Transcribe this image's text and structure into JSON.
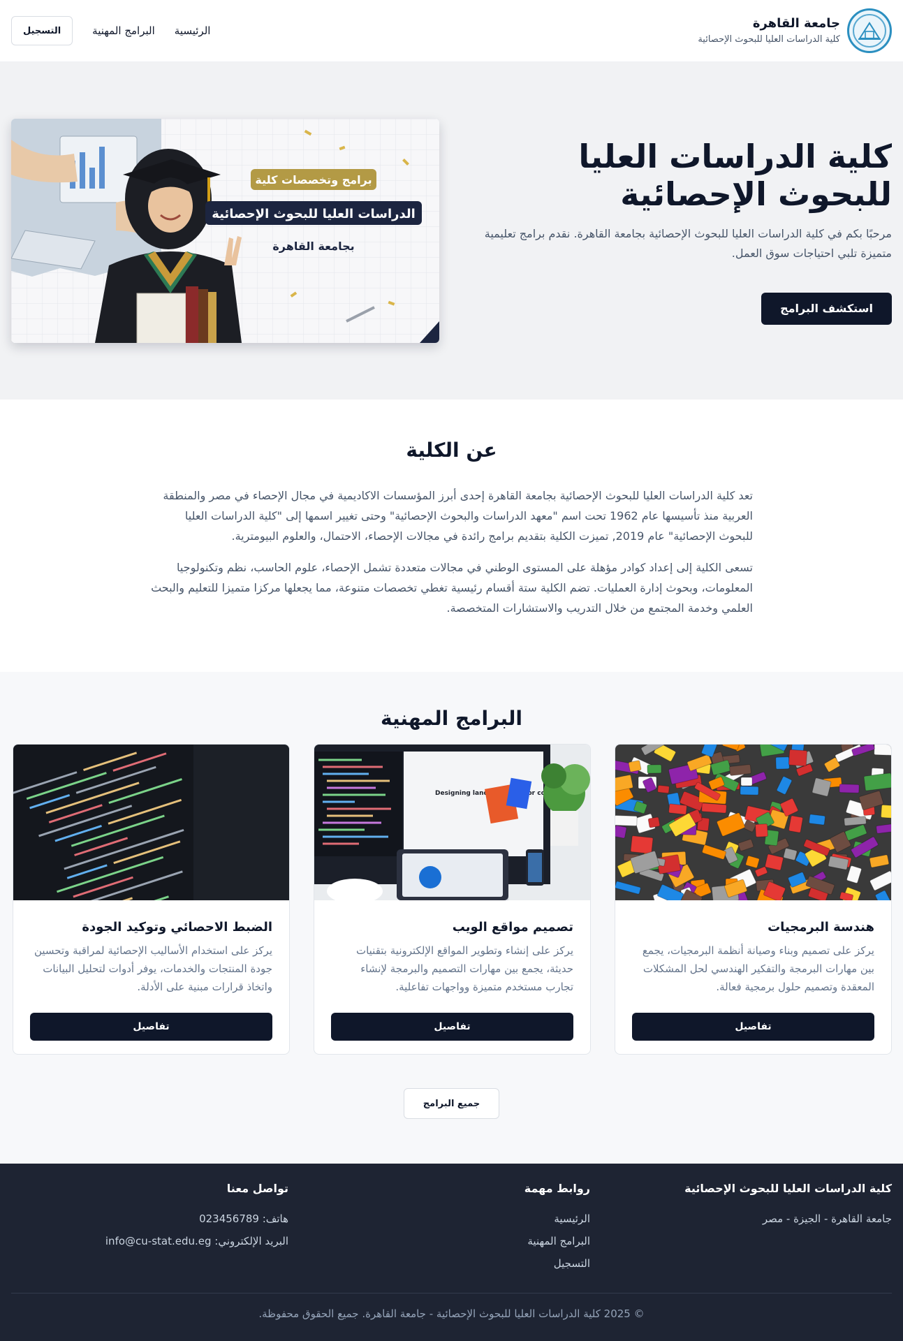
{
  "header": {
    "title": "جامعة القاهرة",
    "subtitle": "كلية الدراسات العليا للبحوث الإحصائية",
    "nav": [
      {
        "label": "الرئيسية"
      },
      {
        "label": "البرامج المهنية"
      }
    ],
    "register_label": "التسجيل"
  },
  "hero": {
    "title": "كلية الدراسات العليا للبحوث الإحصائية",
    "description": "مرحبًا بكم في كلية الدراسات العليا للبحوث الإحصائية بجامعة القاهرة. نقدم برامج تعليمية متميزة تلبي احتياجات سوق العمل.",
    "button_label": "استكشف البرامج",
    "image": {
      "badge": "برامج وتخصصات كلية",
      "headline": "الدراسات العليا للبحوث الإحصائية",
      "tagline": "بجامعة القاهرة"
    }
  },
  "about": {
    "title": "عن الكلية",
    "paragraphs": [
      "تعد كلية الدراسات العليا للبحوث الإحصائية بجامعة القاهرة إحدى أبرز المؤسسات الاكاديمية في مجال الإحصاء في مصر والمنطقة العربية منذ تأسيسها عام 1962 تحت اسم \"معهد الدراسات والبحوث الإحصائية\" وحتى تغيير اسمها إلى \"كلية الدراسات العليا للبحوث الإحصائية\" عام 2019, تميزت الكلية بتقديم برامج رائدة في مجالات الإحصاء، الاحتمال، والعلوم البيومترية.",
      "تسعى الكلية إلى إعداد كوادر مؤهلة على المستوى الوطني في مجالات متعددة تشمل الإحصاء، علوم الحاسب، نظم وتكنولوجيا المعلومات، وبحوث إدارة العمليات. تضم الكلية ستة أقسام رئيسية تغطي تخصصات متنوعة، مما يجعلها مركزا متميزا للتعليم والبحث العلمي وخدمة المجتمع من خلال التدريب والاستشارات المتخصصة."
    ]
  },
  "programs": {
    "title": "البرامج المهنية",
    "cards": [
      {
        "title": "هندسة البرمجيات",
        "description": "يركز على تصميم وبناء وصيانة أنظمة البرمجيات، يجمع بين مهارات البرمجة والتفكير الهندسي لحل المشكلات المعقدة وتصميم حلول برمجية فعالة.",
        "button_label": "تفاصيل",
        "image": "colorful-building-blocks"
      },
      {
        "title": "تصميم مواقع الويب",
        "description": "يركز على إنشاء وتطوير المواقع الإلكترونية بتقنيات حديثة، يجمع بين مهارات التصميم والبرمجة لإنشاء تجارب مستخدم متميزة وواجهات تفاعلية.",
        "button_label": "تفاصيل",
        "image": "web-design-workspace",
        "screen_text": "Designing landing pages for conversion"
      },
      {
        "title": "الضبط الاحصائي وتوكيد الجودة",
        "description": "يركز على استخدام الأساليب الإحصائية لمراقبة وتحسين جودة المنتجات والخدمات، يوفر أدوات لتحليل البيانات واتخاذ قرارات مبنية على الأدلة.",
        "button_label": "تفاصيل",
        "image": "code-on-screen"
      }
    ],
    "all_label": "جميع البرامج"
  },
  "footer": {
    "col1": {
      "title": "كلية الدراسات العليا للبحوث الإحصائية",
      "address": "جامعة القاهرة - الجيزة - مصر"
    },
    "col2": {
      "title": "روابط مهمة",
      "links": [
        "الرئيسية",
        "البرامج المهنية",
        "التسجيل"
      ]
    },
    "col3": {
      "title": "تواصل معنا",
      "phone": "هاتف: 023456789",
      "email": "البريد الإلكتروني: info@cu-stat.edu.eg"
    },
    "copyright": "© 2025 كلية الدراسات العليا للبحوث الإحصائية - جامعة القاهرة. جميع الحقوق محفوظة."
  },
  "colors": {
    "primary": "#0f172a",
    "hero_bg": "#f1f2f4",
    "footer_bg": "#1e2433",
    "gold": "#b39a45"
  }
}
